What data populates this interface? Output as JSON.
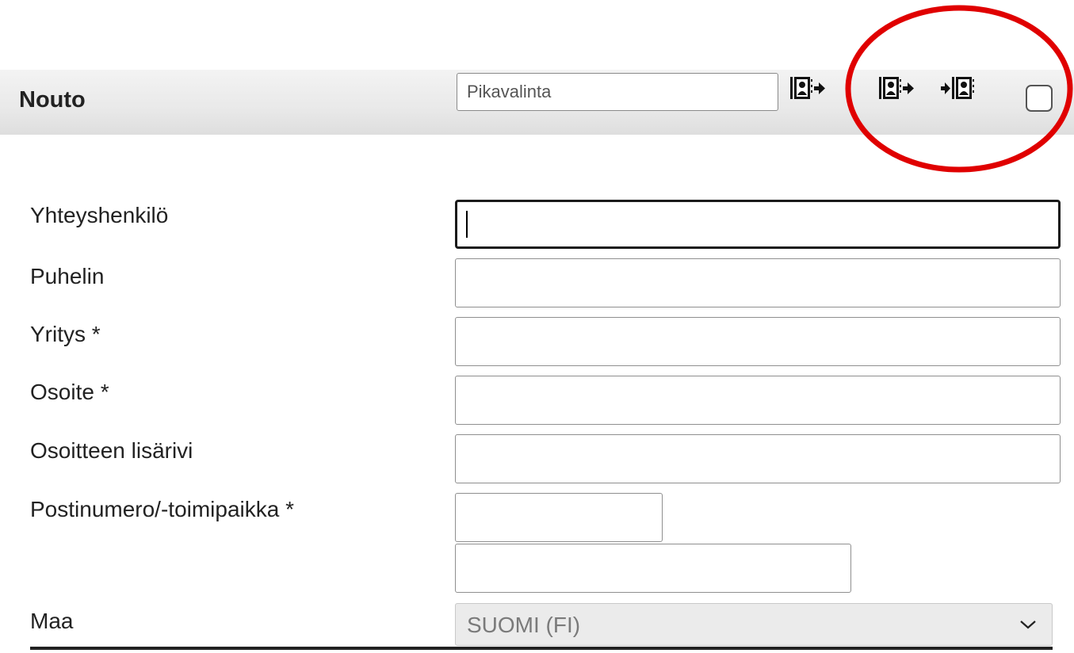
{
  "section": {
    "title": "Nouto"
  },
  "quick_select": {
    "placeholder": "Pikavalinta",
    "value": ""
  },
  "header_icons": [
    "address-book-export-icon",
    "address-book-export-icon",
    "address-book-import-icon"
  ],
  "header_checkbox": {
    "checked": false
  },
  "annotation": {
    "color": "#e00000",
    "shape": "ellipse"
  },
  "form": {
    "fields": [
      {
        "label": "Yhteyshenkilö",
        "value": ""
      },
      {
        "label": "Puhelin",
        "value": ""
      },
      {
        "label": "Yritys *",
        "value": ""
      },
      {
        "label": "Osoite *",
        "value": ""
      },
      {
        "label": "Osoitteen lisärivi",
        "value": ""
      },
      {
        "label": "Postinumero/-toimipaikka *",
        "postal_code": "",
        "city": ""
      }
    ],
    "country": {
      "label": "Maa",
      "selected": "SUOMI (FI)"
    }
  }
}
